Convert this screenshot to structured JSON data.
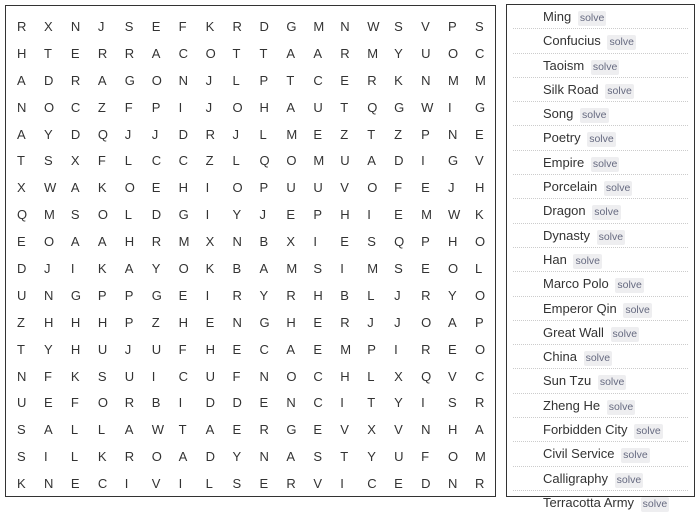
{
  "puzzle": {
    "grid": [
      [
        "R",
        "X",
        "N",
        "J",
        "S",
        "E",
        "F",
        "K",
        "R",
        "D",
        "G",
        "M",
        "N",
        "W",
        "S",
        "V",
        "P",
        "S"
      ],
      [
        "H",
        "T",
        "E",
        "R",
        "R",
        "A",
        "C",
        "O",
        "T",
        "T",
        "A",
        "A",
        "R",
        "M",
        "Y",
        "U",
        "O",
        "C"
      ],
      [
        "A",
        "D",
        "R",
        "A",
        "G",
        "O",
        "N",
        "J",
        "L",
        "P",
        "T",
        "C",
        "E",
        "R",
        "K",
        "N",
        "M",
        "M"
      ],
      [
        "N",
        "O",
        "C",
        "Z",
        "F",
        "P",
        "I",
        "J",
        "O",
        "H",
        "A",
        "U",
        "T",
        "Q",
        "G",
        "W",
        "I",
        "G"
      ],
      [
        "A",
        "Y",
        "D",
        "Q",
        "J",
        "J",
        "D",
        "R",
        "J",
        "L",
        "M",
        "E",
        "Z",
        "T",
        "Z",
        "P",
        "N",
        "E"
      ],
      [
        "T",
        "S",
        "X",
        "F",
        "L",
        "C",
        "C",
        "Z",
        "L",
        "Q",
        "O",
        "M",
        "U",
        "A",
        "D",
        "I",
        "G",
        "V"
      ],
      [
        "X",
        "W",
        "A",
        "K",
        "O",
        "E",
        "H",
        "I",
        "O",
        "P",
        "U",
        "U",
        "V",
        "O",
        "F",
        "E",
        "J",
        "H"
      ],
      [
        "Q",
        "M",
        "S",
        "O",
        "L",
        "D",
        "G",
        "I",
        "Y",
        "J",
        "E",
        "P",
        "H",
        "I",
        "E",
        "M",
        "W",
        "K"
      ],
      [
        "E",
        "O",
        "A",
        "A",
        "H",
        "R",
        "M",
        "X",
        "N",
        "B",
        "X",
        "I",
        "E",
        "S",
        "Q",
        "P",
        "H",
        "O"
      ],
      [
        "D",
        "J",
        "I",
        "K",
        "A",
        "Y",
        "O",
        "K",
        "B",
        "A",
        "M",
        "S",
        "I",
        "M",
        "S",
        "E",
        "O",
        "L"
      ],
      [
        "U",
        "N",
        "G",
        "P",
        "P",
        "G",
        "E",
        "I",
        "R",
        "Y",
        "R",
        "H",
        "B",
        "L",
        "J",
        "R",
        "Y",
        "O"
      ],
      [
        "Z",
        "H",
        "H",
        "H",
        "P",
        "Z",
        "H",
        "E",
        "N",
        "G",
        "H",
        "E",
        "R",
        "J",
        "J",
        "O",
        "A",
        "P"
      ],
      [
        "T",
        "Y",
        "H",
        "U",
        "J",
        "U",
        "F",
        "H",
        "E",
        "C",
        "A",
        "E",
        "M",
        "P",
        "I",
        "R",
        "E",
        "O"
      ],
      [
        "N",
        "F",
        "K",
        "S",
        "U",
        "I",
        "C",
        "U",
        "F",
        "N",
        "O",
        "C",
        "H",
        "L",
        "X",
        "Q",
        "V",
        "C"
      ],
      [
        "U",
        "E",
        "F",
        "O",
        "R",
        "B",
        "I",
        "D",
        "D",
        "E",
        "N",
        "C",
        "I",
        "T",
        "Y",
        "I",
        "S",
        "R"
      ],
      [
        "S",
        "A",
        "L",
        "L",
        "A",
        "W",
        "T",
        "A",
        "E",
        "R",
        "G",
        "E",
        "V",
        "X",
        "V",
        "N",
        "H",
        "A"
      ],
      [
        "S",
        "I",
        "L",
        "K",
        "R",
        "O",
        "A",
        "D",
        "Y",
        "N",
        "A",
        "S",
        "T",
        "Y",
        "U",
        "F",
        "O",
        "M"
      ],
      [
        "K",
        "N",
        "E",
        "C",
        "I",
        "V",
        "I",
        "L",
        "S",
        "E",
        "R",
        "V",
        "I",
        "C",
        "E",
        "D",
        "N",
        "R"
      ]
    ]
  },
  "word_list": {
    "solve_label": "solve",
    "words": [
      "Ming",
      "Confucius",
      "Taoism",
      "Silk Road",
      "Song",
      "Poetry",
      "Empire",
      "Porcelain",
      "Dragon",
      "Dynasty",
      "Han",
      "Marco Polo",
      "Emperor Qin",
      "Great Wall",
      "China",
      "Sun Tzu",
      "Zheng He",
      "Forbidden City",
      "Civil Service",
      "Calligraphy",
      "Terracotta Army"
    ]
  }
}
